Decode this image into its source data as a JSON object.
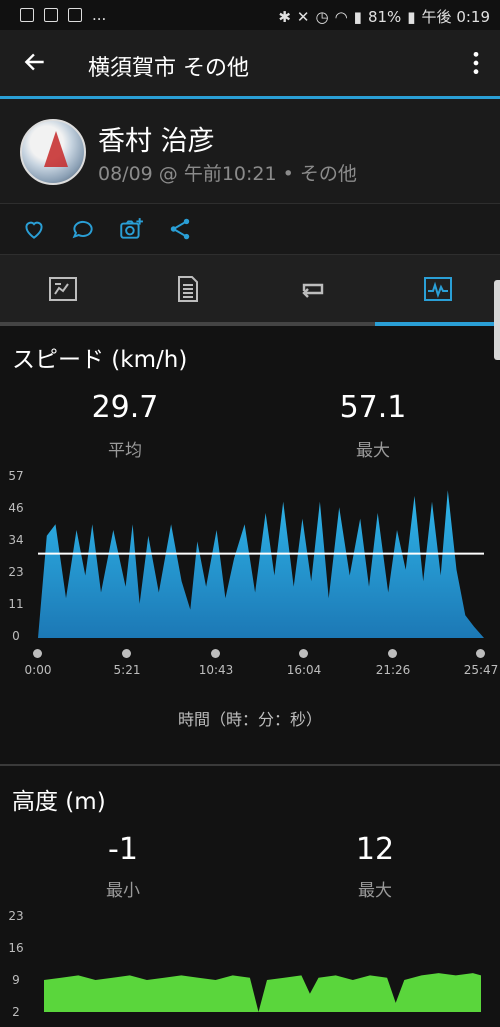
{
  "status_bar": {
    "battery": "81%",
    "time": "午後 0:19",
    "notification_more": "..."
  },
  "app_bar": {
    "title": "横須賀市 その他"
  },
  "profile": {
    "name": "香村 治彦",
    "meta": "08/09 @ 午前10:21 • その他"
  },
  "colors": {
    "accent": "#2a9fd6",
    "speed_fill": "#2a9fd6",
    "elevation_fill": "#5ad63c"
  },
  "tabs": [
    "summary-tab",
    "details-tab",
    "laps-tab",
    "charts-tab"
  ],
  "speed": {
    "title": "スピード (km/h)",
    "avg": {
      "value": "29.7",
      "label": "平均"
    },
    "max": {
      "value": "57.1",
      "label": "最大"
    },
    "y_ticks": [
      "57",
      "46",
      "34",
      "23",
      "11",
      "0"
    ],
    "x_ticks": [
      "0:00",
      "5:21",
      "10:43",
      "16:04",
      "21:26",
      "25:47"
    ],
    "x_axis_title": "時間（時：分：秒）"
  },
  "elevation": {
    "title": "高度 (m)",
    "min": {
      "value": "-1",
      "label": "最小"
    },
    "max": {
      "value": "12",
      "label": "最大"
    },
    "y_ticks": [
      "23",
      "16",
      "9",
      "2"
    ]
  },
  "chart_data": [
    {
      "type": "area",
      "title": "スピード (km/h)",
      "xlabel": "時間（時：分：秒）",
      "ylabel": "",
      "x_ticks": [
        "0:00",
        "5:21",
        "10:43",
        "16:04",
        "21:26",
        "25:47"
      ],
      "ylim": [
        0,
        57
      ],
      "average_line": 29.7,
      "x": [
        0.0,
        0.5,
        1.0,
        1.6,
        2.2,
        2.7,
        3.1,
        3.6,
        4.3,
        5.0,
        5.4,
        5.8,
        6.3,
        6.9,
        7.6,
        8.2,
        8.7,
        9.1,
        9.6,
        10.2,
        10.7,
        11.2,
        11.8,
        12.4,
        13.0,
        13.5,
        14.0,
        14.6,
        15.1,
        15.6,
        16.1,
        16.6,
        17.2,
        17.8,
        18.4,
        18.9,
        19.4,
        20.0,
        20.5,
        21.0,
        21.5,
        22.0,
        22.5,
        23.0,
        23.4,
        23.9,
        24.4,
        24.9,
        25.47
      ],
      "values": [
        0,
        36,
        40,
        14,
        38,
        22,
        40,
        16,
        38,
        18,
        40,
        12,
        36,
        16,
        40,
        20,
        10,
        34,
        18,
        38,
        14,
        28,
        40,
        16,
        44,
        22,
        48,
        18,
        42,
        20,
        48,
        14,
        46,
        22,
        42,
        18,
        44,
        16,
        38,
        24,
        50,
        20,
        48,
        22,
        52,
        24,
        8,
        4,
        0
      ]
    },
    {
      "type": "area",
      "title": "高度 (m)",
      "xlabel": "",
      "ylabel": "",
      "ylim": [
        2,
        23
      ],
      "x": [
        0.0,
        1.0,
        2.0,
        3.0,
        4.0,
        5.0,
        6.0,
        7.0,
        8.0,
        9.0,
        10.0,
        11.0,
        12.0,
        12.5,
        13.0,
        14.0,
        15.0,
        15.5,
        16.0,
        17.0,
        18.0,
        19.0,
        20.0,
        20.5,
        21.0,
        22.0,
        23.0,
        24.0,
        25.0,
        25.47
      ],
      "values": [
        9,
        9.5,
        10,
        9,
        9.5,
        10,
        9,
        9.5,
        10,
        9.5,
        9,
        10,
        9.5,
        -1,
        9,
        9.5,
        10,
        6,
        9.5,
        10,
        9,
        10,
        9.5,
        4,
        9,
        10,
        10.5,
        10,
        10.5,
        10
      ]
    }
  ]
}
